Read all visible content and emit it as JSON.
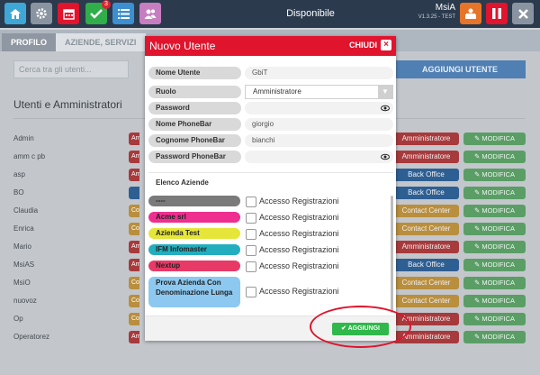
{
  "topbar": {
    "status": "Disponibile",
    "user_name": "MsiA",
    "user_sub": "V1.3.25 - TEST",
    "notifications_count": "3",
    "icons": [
      "home-icon",
      "gear-icon",
      "calendar-icon",
      "checkmark-icon",
      "list-icon",
      "people-icon",
      "receptionist-icon",
      "pause-icon",
      "close-icon"
    ]
  },
  "tabs": [
    {
      "label": "PROFILO"
    },
    {
      "label": "AZIENDE, SERVIZI E"
    }
  ],
  "page": {
    "search_placeholder": "Cerca tra gli utenti...",
    "add_user_label": "AGGIUNGI UTENTE",
    "section_title": "Utenti e Amministratori",
    "modify_label": "MODIFICA",
    "users": [
      {
        "name": "Admin",
        "left": "Am",
        "role": "Amministratore",
        "kind": "admin"
      },
      {
        "name": "amm c pb",
        "left": "Am",
        "role": "Amministratore",
        "kind": "admin"
      },
      {
        "name": "asp",
        "left": "Am",
        "role": "Back Office",
        "kind": "back"
      },
      {
        "name": "BO",
        "left": "",
        "role": "Back Office",
        "kind": "back"
      },
      {
        "name": "Claudia",
        "left": "Co",
        "role": "Contact Center",
        "kind": "cc"
      },
      {
        "name": "Enrica",
        "left": "Co",
        "role": "Contact Center",
        "kind": "cc"
      },
      {
        "name": "Mario",
        "left": "Am",
        "role": "Amministratore",
        "kind": "admin"
      },
      {
        "name": "MsiAS",
        "left": "Am",
        "role": "Back Office",
        "kind": "back"
      },
      {
        "name": "MsiO",
        "left": "Co",
        "role": "Contact Center",
        "kind": "cc"
      },
      {
        "name": "nuovoz",
        "left": "Co",
        "role": "Contact Center",
        "kind": "cc"
      },
      {
        "name": "Op",
        "left": "Co",
        "role": "Amministratore",
        "kind": "admin"
      },
      {
        "name": "Operatorez",
        "left": "Am",
        "role": "Amministratore",
        "kind": "admin"
      }
    ]
  },
  "modal": {
    "title": "Nuovo Utente",
    "close_label": "CHIUDI",
    "fields": [
      {
        "label": "Nome Utente",
        "value": "GbiT"
      },
      {
        "label": "Ruolo",
        "value": "Amministratore"
      },
      {
        "label": "Password",
        "value": ""
      },
      {
        "label": "Nome PhoneBar",
        "value": "giorgio"
      },
      {
        "label": "Cognome PhoneBar",
        "value": "bianchi"
      },
      {
        "label": "Password PhoneBar",
        "value": ""
      }
    ],
    "companies_title": "Elenco Aziende",
    "access_label": "Accesso Registrazioni",
    "companies": [
      {
        "name": "----",
        "color": "#7a7a7a"
      },
      {
        "name": "Acme srl",
        "color": "#ee2f8f"
      },
      {
        "name": "Azienda Test",
        "color": "#e6e63a"
      },
      {
        "name": "IFM Infomaster",
        "color": "#22aebf"
      },
      {
        "name": "Nextup",
        "color": "#e83a67"
      },
      {
        "name": "Prova Azienda Con Denominazione Lunga",
        "color": "#8cc8ef"
      }
    ],
    "submit_label": "AGGIUNGI"
  },
  "colors": {
    "topbar": "#2b3a4d",
    "modal_header": "#e0142d",
    "submit": "#30b84a",
    "modify": "#5a9e66",
    "admin": "#a73a3c",
    "back_office": "#2e5f93",
    "contact_center": "#b98e3d"
  }
}
